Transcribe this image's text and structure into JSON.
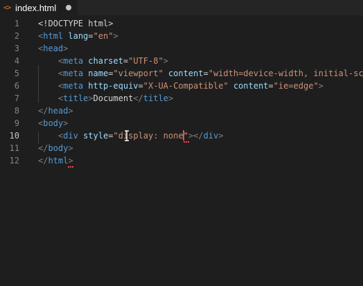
{
  "tab": {
    "icon": "<>",
    "filename": "index.html",
    "dirty": true
  },
  "editor": {
    "active_line": 10,
    "lines": [
      {
        "n": "1",
        "tokens": [
          [
            "t-doc",
            "<!DOCTYPE html>"
          ]
        ]
      },
      {
        "n": "2",
        "tokens": [
          [
            "t-bracket",
            "<"
          ],
          [
            "t-tag",
            "html"
          ],
          [
            "t-text",
            " "
          ],
          [
            "t-attr",
            "lang"
          ],
          [
            "t-text",
            "="
          ],
          [
            "t-str",
            "\"en\""
          ],
          [
            "t-bracket",
            ">"
          ]
        ]
      },
      {
        "n": "3",
        "tokens": [
          [
            "t-bracket",
            "<"
          ],
          [
            "t-tag",
            "head"
          ],
          [
            "t-bracket",
            ">"
          ]
        ]
      },
      {
        "n": "4",
        "tokens": [
          [
            "t-text",
            "    "
          ],
          [
            "t-bracket",
            "<"
          ],
          [
            "t-tag",
            "meta"
          ],
          [
            "t-text",
            " "
          ],
          [
            "t-attr",
            "charset"
          ],
          [
            "t-text",
            "="
          ],
          [
            "t-str",
            "\"UTF-8\""
          ],
          [
            "t-bracket",
            ">"
          ]
        ]
      },
      {
        "n": "5",
        "tokens": [
          [
            "t-text",
            "    "
          ],
          [
            "t-bracket",
            "<"
          ],
          [
            "t-tag",
            "meta"
          ],
          [
            "t-text",
            " "
          ],
          [
            "t-attr",
            "name"
          ],
          [
            "t-text",
            "="
          ],
          [
            "t-str",
            "\"viewport\""
          ],
          [
            "t-text",
            " "
          ],
          [
            "t-attr",
            "content"
          ],
          [
            "t-text",
            "="
          ],
          [
            "t-str",
            "\"width=device-width, initial-sc"
          ]
        ]
      },
      {
        "n": "6",
        "tokens": [
          [
            "t-text",
            "    "
          ],
          [
            "t-bracket",
            "<"
          ],
          [
            "t-tag",
            "meta"
          ],
          [
            "t-text",
            " "
          ],
          [
            "t-attr",
            "http-equiv"
          ],
          [
            "t-text",
            "="
          ],
          [
            "t-str",
            "\"X-UA-Compatible\""
          ],
          [
            "t-text",
            " "
          ],
          [
            "t-attr",
            "content"
          ],
          [
            "t-text",
            "="
          ],
          [
            "t-str",
            "\"ie=edge\""
          ],
          [
            "t-bracket",
            ">"
          ]
        ]
      },
      {
        "n": "7",
        "tokens": [
          [
            "t-text",
            "    "
          ],
          [
            "t-bracket",
            "<"
          ],
          [
            "t-tag",
            "title"
          ],
          [
            "t-bracket",
            ">"
          ],
          [
            "t-text",
            "Document"
          ],
          [
            "t-bracket",
            "</"
          ],
          [
            "t-tag",
            "title"
          ],
          [
            "t-bracket",
            ">"
          ]
        ]
      },
      {
        "n": "8",
        "tokens": [
          [
            "t-bracket",
            "</"
          ],
          [
            "t-tag",
            "head"
          ],
          [
            "t-bracket",
            ">"
          ]
        ]
      },
      {
        "n": "9",
        "tokens": [
          [
            "t-bracket",
            "<"
          ],
          [
            "t-tag",
            "body"
          ],
          [
            "t-bracket",
            ">"
          ]
        ]
      },
      {
        "n": "10",
        "tokens": [
          [
            "t-text",
            "    "
          ],
          [
            "t-bracket",
            "<"
          ],
          [
            "t-tag",
            "div"
          ],
          [
            "t-text",
            " "
          ],
          [
            "t-attr",
            "style"
          ],
          [
            "t-text",
            "="
          ],
          [
            "t-str",
            "\"display: none"
          ],
          [
            "t-str",
            "\""
          ],
          [
            "t-bracket",
            "></"
          ],
          [
            "t-tag",
            "div"
          ],
          [
            "t-bracket",
            ">"
          ]
        ]
      },
      {
        "n": "11",
        "tokens": [
          [
            "t-bracket",
            "</"
          ],
          [
            "t-tag",
            "body"
          ],
          [
            "t-bracket",
            ">"
          ]
        ]
      },
      {
        "n": "12",
        "tokens": [
          [
            "t-bracket",
            "</"
          ],
          [
            "t-tag",
            "html"
          ],
          [
            "t-bracket",
            ">"
          ]
        ]
      }
    ]
  }
}
